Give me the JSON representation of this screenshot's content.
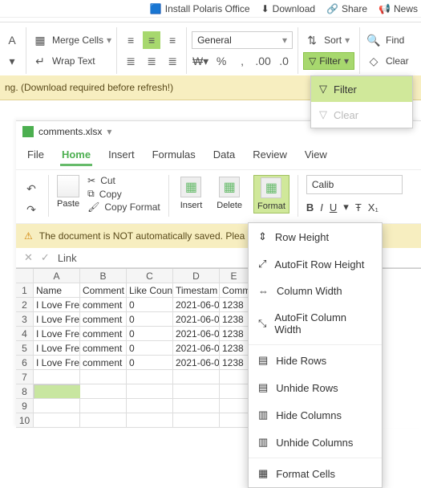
{
  "top": {
    "install": "Install Polaris Office",
    "download": "Download",
    "share": "Share",
    "news": "News"
  },
  "ribbon1": {
    "merge": "Merge Cells",
    "wrap": "Wrap Text",
    "numfmt": "General",
    "sort": "Sort",
    "filter": "Filter",
    "find": "Find",
    "clear": "Clear",
    "pct": "%",
    "comma": ",",
    "dec1": ".0",
    "dec2": ".00"
  },
  "filter_dd": {
    "filter": "Filter",
    "clear": "Clear"
  },
  "warn1": "ng. (Download required before refresh!)",
  "doc": {
    "filename": "comments.xlsx",
    "menus": [
      "File",
      "Home",
      "Insert",
      "Formulas",
      "Data",
      "Review",
      "View"
    ],
    "paste": "Paste",
    "cut": "Cut",
    "copy": "Copy",
    "copyfmt": "Copy Format",
    "insert": "Insert",
    "delete": "Delete",
    "format": "Format",
    "font": "Calib",
    "warn": "The document is NOT automatically saved. Plea",
    "link": "Link"
  },
  "grid": {
    "cols": [
      "A",
      "B",
      "C",
      "D",
      "E"
    ],
    "headers": [
      "Name",
      "Comment",
      "Like Coun",
      "Timestam",
      "Comm"
    ],
    "rows": [
      [
        "I Love Fre",
        "comment",
        "0",
        "2021-06-0",
        "1238"
      ],
      [
        "I Love Fre",
        "comment",
        "0",
        "2021-06-0",
        "1238"
      ],
      [
        "I Love Fre",
        "comment",
        "0",
        "2021-06-0",
        "1238"
      ],
      [
        "I Love Fre",
        "comment",
        "0",
        "2021-06-0",
        "1238"
      ],
      [
        "I Love Fre",
        "comment",
        "0",
        "2021-06-0",
        "1238"
      ]
    ],
    "empty_rows": [
      "7",
      "8",
      "9",
      "10"
    ]
  },
  "fmt_dd": {
    "row_height": "Row Height",
    "autofit_row": "AutoFit Row Height",
    "col_width": "Column Width",
    "autofit_col": "AutoFit Column Width",
    "hide_rows": "Hide Rows",
    "unhide_rows": "Unhide Rows",
    "hide_cols": "Hide Columns",
    "unhide_cols": "Unhide Columns",
    "fmt_cells": "Format Cells"
  }
}
